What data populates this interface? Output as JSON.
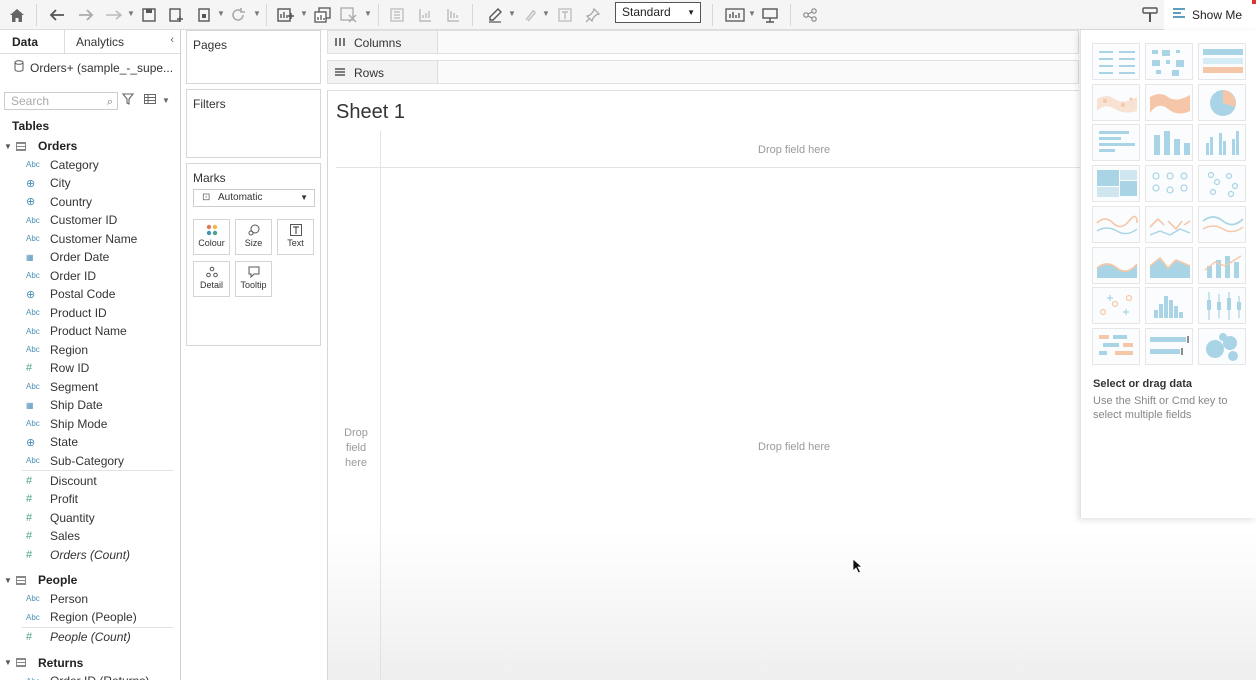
{
  "toolbar": {
    "view_select": "Standard",
    "show_me": "Show Me"
  },
  "datapane": {
    "tabs": {
      "data": "Data",
      "analytics": "Analytics"
    },
    "datasource": "Orders+ (sample_-_supe...",
    "search_placeholder": "Search",
    "tables_heading": "Tables",
    "groups": [
      {
        "name": "Orders",
        "fields": [
          {
            "label": "Category",
            "type": "Abc"
          },
          {
            "label": "City",
            "type": "geo"
          },
          {
            "label": "Country",
            "type": "geo"
          },
          {
            "label": "Customer ID",
            "type": "Abc"
          },
          {
            "label": "Customer Name",
            "type": "Abc"
          },
          {
            "label": "Order Date",
            "type": "date"
          },
          {
            "label": "Order ID",
            "type": "Abc"
          },
          {
            "label": "Postal Code",
            "type": "geo"
          },
          {
            "label": "Product ID",
            "type": "Abc"
          },
          {
            "label": "Product Name",
            "type": "Abc"
          },
          {
            "label": "Region",
            "type": "Abc"
          },
          {
            "label": "Row ID",
            "type": "num"
          },
          {
            "label": "Segment",
            "type": "Abc"
          },
          {
            "label": "Ship Date",
            "type": "date"
          },
          {
            "label": "Ship Mode",
            "type": "Abc"
          },
          {
            "label": "State",
            "type": "geo"
          },
          {
            "label": "Sub-Category",
            "type": "Abc"
          }
        ],
        "measures": [
          {
            "label": "Discount"
          },
          {
            "label": "Profit"
          },
          {
            "label": "Quantity"
          },
          {
            "label": "Sales"
          },
          {
            "label": "Orders (Count)",
            "italic": true
          }
        ]
      },
      {
        "name": "People",
        "fields": [
          {
            "label": "Person",
            "type": "Abc"
          },
          {
            "label": "Region (People)",
            "type": "Abc"
          }
        ],
        "measures": [
          {
            "label": "People (Count)",
            "italic": true
          }
        ]
      },
      {
        "name": "Returns",
        "fields": [
          {
            "label": "Order ID (Returns)",
            "type": "Abc"
          }
        ]
      }
    ]
  },
  "cards": {
    "pages": "Pages",
    "filters": "Filters",
    "marks": "Marks",
    "mark_type": "Automatic",
    "buttons": [
      "Colour",
      "Size",
      "Text",
      "Detail",
      "Tooltip"
    ]
  },
  "shelves": {
    "columns": "Columns",
    "rows": "Rows"
  },
  "canvas": {
    "sheet_title": "Sheet 1",
    "drop_top": "Drop field here",
    "drop_middle": "Drop field here",
    "drop_left": "Drop field here"
  },
  "show_me_panel": {
    "title": "Select or drag data",
    "hint": "Use the Shift or Cmd key to select multiple fields"
  },
  "colors": {
    "dimension_icon": "#4a90b8",
    "measure_icon": "#4aa38b",
    "chart_blue": "#a9d4e6",
    "chart_orange": "#f5c7a8"
  }
}
